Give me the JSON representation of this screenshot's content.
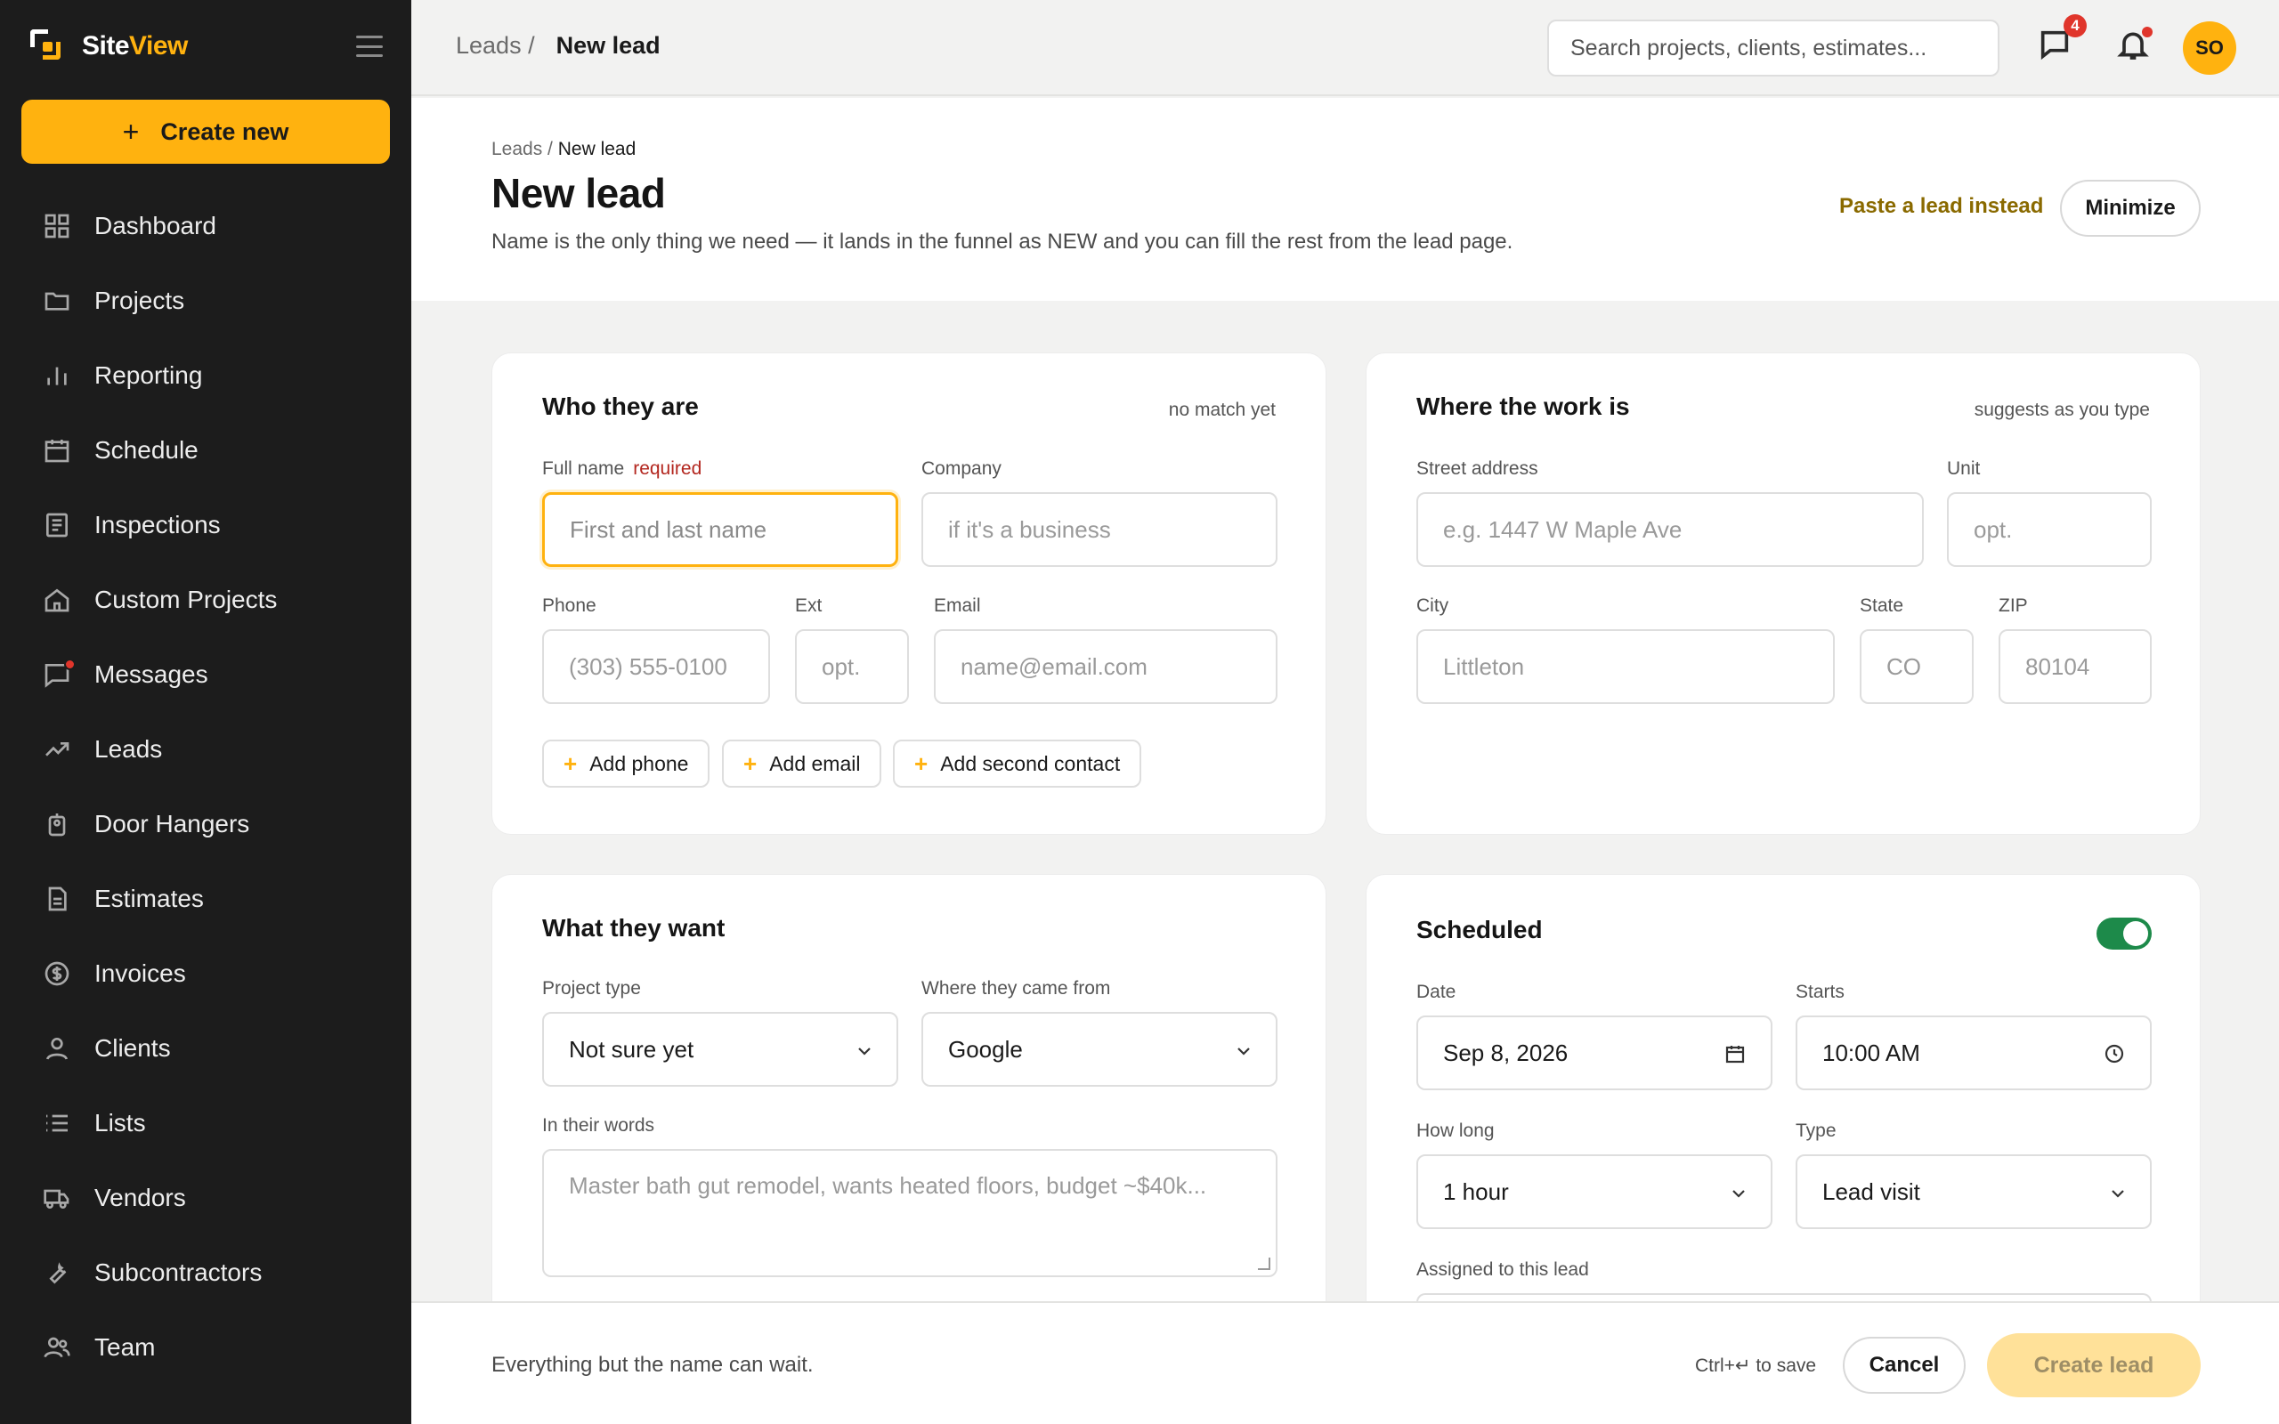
{
  "app": {
    "brand_part1": "Site",
    "brand_part2": "View"
  },
  "sidebar": {
    "create_label": "Create new",
    "items": [
      {
        "label": "Dashboard",
        "icon": "grid-icon"
      },
      {
        "label": "Projects",
        "icon": "folder-icon"
      },
      {
        "label": "Reporting",
        "icon": "bar-chart-icon"
      },
      {
        "label": "Schedule",
        "icon": "calendar-icon"
      },
      {
        "label": "Inspections",
        "icon": "checklist-icon"
      },
      {
        "label": "Custom Projects",
        "icon": "house-icon"
      },
      {
        "label": "Messages",
        "icon": "chat-icon"
      },
      {
        "label": "Leads",
        "icon": "trend-icon"
      },
      {
        "label": "Door Hangers",
        "icon": "tag-icon"
      },
      {
        "label": "Estimates",
        "icon": "document-icon"
      },
      {
        "label": "Invoices",
        "icon": "dollar-icon"
      },
      {
        "label": "Clients",
        "icon": "user-icon"
      },
      {
        "label": "Lists",
        "icon": "list-icon"
      },
      {
        "label": "Vendors",
        "icon": "truck-icon"
      },
      {
        "label": "Subcontractors",
        "icon": "wrench-icon"
      },
      {
        "label": "Team",
        "icon": "team-icon"
      }
    ]
  },
  "topbar": {
    "crumb_parent": "Leads /",
    "crumb_current": "New lead",
    "search_placeholder": "Search projects, clients, estimates...",
    "messages_badge": "4",
    "avatar_initials": "SO"
  },
  "header": {
    "crumb_parent": "Leads / ",
    "crumb_current": "New lead",
    "title": "New lead",
    "subtitle": "Name is the only thing we need — it lands in the funnel as NEW and you can fill the rest from the lead page.",
    "paste_link": "Paste a lead instead",
    "minimize_label": "Minimize"
  },
  "who": {
    "title": "Who they are",
    "note": "no match yet",
    "full_name_label": "Full name",
    "required_label": "required",
    "full_name_placeholder": "First and last name",
    "company_label": "Company",
    "company_placeholder": "if it's a business",
    "phone_label": "Phone",
    "phone_placeholder": "(303) 555-0100",
    "ext_label": "Ext",
    "ext_placeholder": "opt.",
    "email_label": "Email",
    "email_placeholder": "name@email.com",
    "add_phone": "Add phone",
    "add_email": "Add email",
    "add_contact": "Add second contact"
  },
  "where": {
    "title": "Where the work is",
    "note": "suggests as you type",
    "street_label": "Street address",
    "street_placeholder": "e.g. 1447 W Maple Ave",
    "unit_label": "Unit",
    "unit_placeholder": "opt.",
    "city_label": "City",
    "city_placeholder": "Littleton",
    "state_label": "State",
    "state_placeholder": "CO",
    "zip_label": "ZIP",
    "zip_placeholder": "80104"
  },
  "want": {
    "title": "What they want",
    "project_type_label": "Project type",
    "project_type_value": "Not sure yet",
    "source_label": "Where they came from",
    "source_value": "Google",
    "words_label": "In their words",
    "words_placeholder": "Master bath gut remodel, wants heated floors, budget ~$40k..."
  },
  "scheduled": {
    "title": "Scheduled",
    "enabled": true,
    "date_label": "Date",
    "date_value": "Sep 8, 2026",
    "starts_label": "Starts",
    "starts_value": "10:00 AM",
    "duration_label": "How long",
    "duration_value": "1 hour",
    "type_label": "Type",
    "type_value": "Lead visit",
    "assigned_label": "Assigned to this lead"
  },
  "footer": {
    "text": "Everything but the name can wait.",
    "hint": "Ctrl+↵ to save",
    "cancel_label": "Cancel",
    "create_label": "Create lead"
  },
  "colors": {
    "accent": "#ffb20f",
    "sidebar": "#1c1c1c",
    "toggle_on": "#1d8a4a",
    "danger": "#e0352b"
  }
}
